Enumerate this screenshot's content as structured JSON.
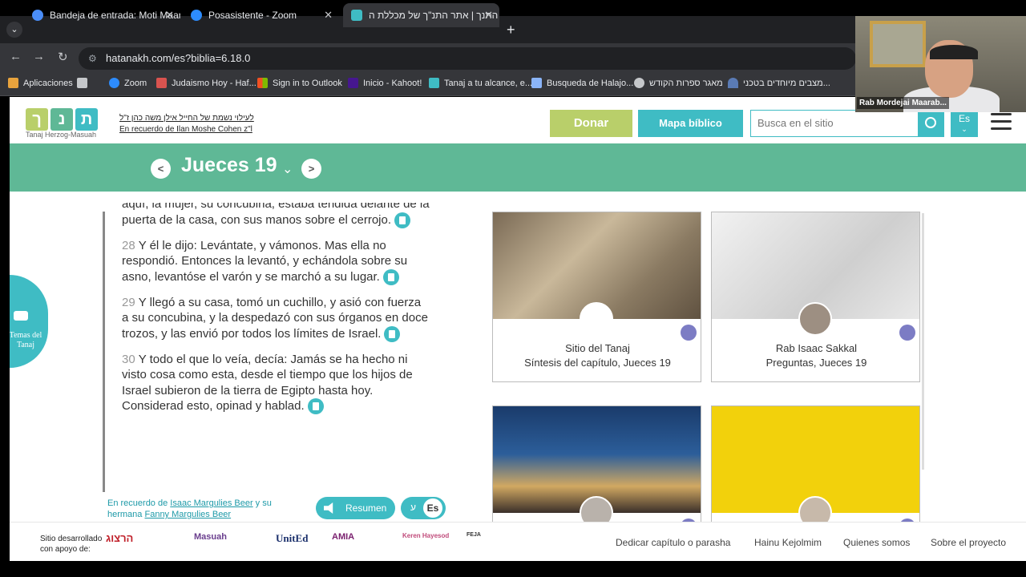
{
  "browser": {
    "tabs": [
      {
        "title": "Bandeja de entrada: Moti Maar..."
      },
      {
        "title": "Posasistente - Zoom"
      },
      {
        "title": "התנך | אתר התנ\"ך של מכללת ה"
      }
    ],
    "url": "hatanakh.com/es?biblia=6.18.0",
    "bookmarks": [
      "Aplicaciones",
      "Zoom",
      "Judaismo Hoy - Haf...",
      "Sign in to Outlook",
      "Inicio - Kahoot!",
      "Tanaj a tu alcance, e...",
      "Busqueda de Halajo...",
      "מאגר ספרות הקודש",
      "מצבים מיוחדים בטכני..."
    ]
  },
  "site": {
    "logo_letters": [
      "ת",
      "נ",
      "ך"
    ],
    "logo_caption": "Tanaj Herzog-Masuah",
    "dedication_he": "לעילוי נשמת של החייל אילן משה כהן ז\"ל",
    "dedication_es": "En recuerdo de Ilan Moshe Cohen z\"l",
    "donar": "Donar",
    "mapa": "Mapa bíblico",
    "search_placeholder": "Busca en el sitio",
    "lang": "Es"
  },
  "chapter": {
    "prev": "<",
    "next": ">",
    "title": "Jueces 19"
  },
  "sidebar": {
    "temas_label": "Temas del Tanaj"
  },
  "verses": [
    {
      "num": "",
      "text": "aquí, la mujer, su concubina, estaba tendida delante de la puerta de la casa, con sus manos sobre el cerrojo."
    },
    {
      "num": "28",
      "text": "Y él le dijo: Levántate, y vámonos. Mas ella no respondió. Entonces la levantó, y echándola sobre su asno, levantóse el varón y se marchó a su lugar."
    },
    {
      "num": "29",
      "text": "Y llegó a su casa, tomó un cuchillo, y asió con fuerza a su concubina, y la despedazó con sus órganos en doce trozos, y las envió por todos los límites de Israel."
    },
    {
      "num": "30",
      "text": "Y todo el que lo veía, decía: Jamás se ha hecho ni visto cosa como esta, desde el tiempo que los hijos de Israel subieron de la tierra de Egipto hasta hoy. Considerad esto, opinad y hablad."
    }
  ],
  "cards": [
    {
      "author": "Sitio del Tanaj",
      "title": "Síntesis del capítulo, Jueces 19"
    },
    {
      "author": "Rab Isaac Sakkal",
      "title": "Preguntas, Jueces 19"
    },
    {
      "author": "",
      "title": ""
    },
    {
      "author": "",
      "title": ""
    }
  ],
  "bottom": {
    "memorial_prefix": "En recuerdo de ",
    "memorial_name1": "Isaac Margulies Beer",
    "memorial_mid": " y su",
    "memorial_prefix2": "hermana ",
    "memorial_name2": "Fanny Margulies Beer",
    "resumen": "Resumen",
    "lang_he": "ע",
    "lang_es": "Es"
  },
  "footer": {
    "sponsor_label": "Sitio desarrollado con apoyo de:",
    "sponsors": [
      "הרצוג",
      "Masuah",
      "UnitEd",
      "AMIA",
      "Keren Hayesod",
      "FEJA"
    ],
    "links": [
      "Dedicar capítulo o parasha",
      "Hainu Kejolmim",
      "Quienes somos",
      "Sobre el proyecto"
    ]
  },
  "video": {
    "name": "Rab Mordejai Maarab..."
  }
}
